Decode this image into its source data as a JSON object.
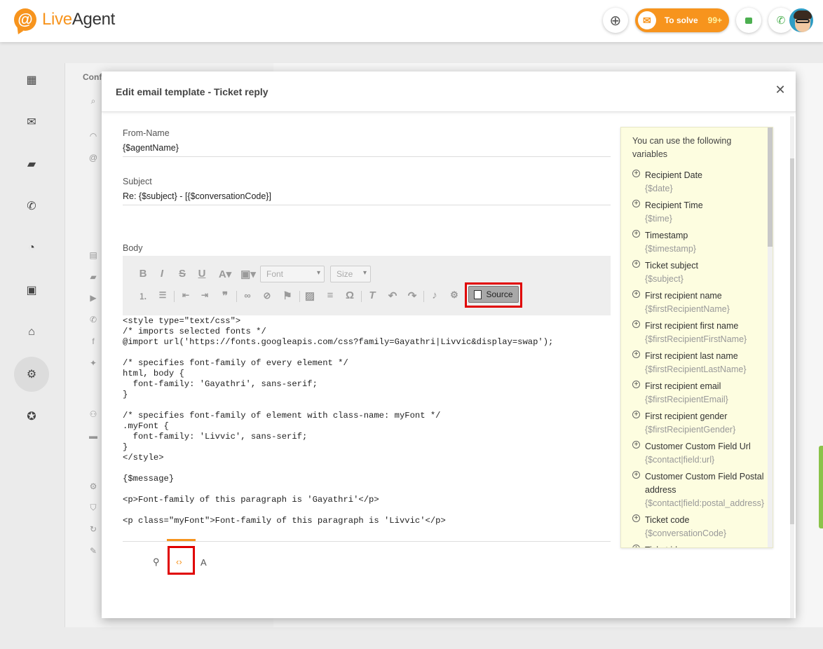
{
  "app": {
    "logo_live": "Live",
    "logo_agent": "Agent",
    "to_solve_label": "To solve",
    "to_solve_count": "99+"
  },
  "modal": {
    "title": "Edit email template - Ticket reply",
    "from_name_label": "From-Name",
    "from_name_value": "{$agentName}",
    "subject_label": "Subject",
    "subject_value": "Re: {$subject} - [{$conversationCode}]",
    "body_label": "Body"
  },
  "toolbar": {
    "font_placeholder": "Font",
    "size_placeholder": "Size",
    "source_label": "Source"
  },
  "editor": {
    "code_lines": [
      "<style type=\"text/css\">",
      "/* imports selected fonts */",
      "@import url('https://fonts.googleapis.com/css?family=Gayathri|Livvic&display=swap');",
      "",
      "/* specifies font-family of every element */",
      "html, body {",
      "  font-family: 'Gayathri', sans-serif;",
      "}",
      "",
      "/* specifies font-family of element with class-name: myFont */",
      ".myFont {",
      "  font-family: 'Livvic', sans-serif;",
      "}",
      "</style>",
      "",
      "{$message}",
      "",
      "<p>Font-family of this paragraph is 'Gayathri'</p>",
      "",
      "<p class=\"myFont\">Font-family of this paragraph is 'Livvic'</p>"
    ],
    "bottom_a_label": "A"
  },
  "variables": {
    "intro": "You can use the following variables",
    "items": [
      {
        "name": "Recipient Date",
        "code": "{$date}"
      },
      {
        "name": "Recipient Time",
        "code": "{$time}"
      },
      {
        "name": "Timestamp",
        "code": "{$timestamp}"
      },
      {
        "name": "Ticket subject",
        "code": "{$subject}"
      },
      {
        "name": "First recipient name",
        "code": "{$firstRecipientName}"
      },
      {
        "name": "First recipient first name",
        "code": "{$firstRecipientFirstName}"
      },
      {
        "name": "First recipient last name",
        "code": "{$firstRecipientLastName}"
      },
      {
        "name": "First recipient email",
        "code": "{$firstRecipientEmail}"
      },
      {
        "name": "First recipient gender",
        "code": "{$firstRecipientGender}"
      },
      {
        "name": "Customer Custom Field Url",
        "code": "{$contact|field:url}"
      },
      {
        "name": "Customer Custom Field Postal address",
        "code": "{$contact|field:postal_address}"
      },
      {
        "name": "Ticket code",
        "code": "{$conversationCode}"
      },
      {
        "name": "Ticket id",
        "code": ""
      }
    ]
  },
  "background": {
    "panel_label": "Conf"
  },
  "colors": {
    "brand": "#f7941d",
    "highlight": "#e00000",
    "variables_bg": "#fdfde0"
  }
}
